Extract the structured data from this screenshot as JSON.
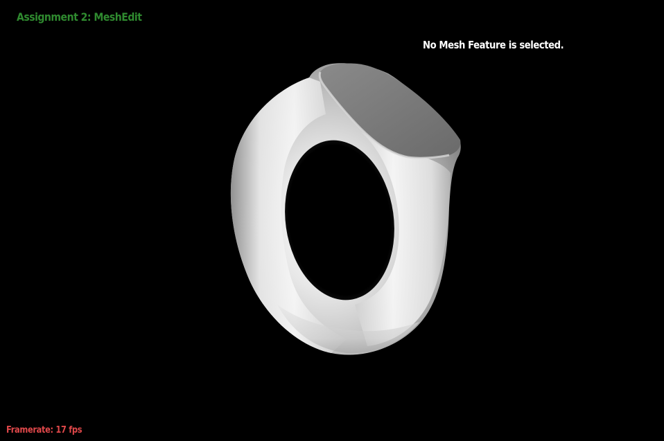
{
  "app": {
    "title": "Assignment 2: MeshEdit"
  },
  "hud": {
    "selection_status": "No Mesh Feature is selected.",
    "framerate_label": "Framerate: 17 fps"
  },
  "colors": {
    "background": "#000000",
    "title": "#2f8a2f",
    "status": "#ffffff",
    "framerate": "#e0484a",
    "mesh_light": "#f4f4f4",
    "mesh_dark": "#555555"
  },
  "viewport": {
    "model": "ring-mesh"
  }
}
